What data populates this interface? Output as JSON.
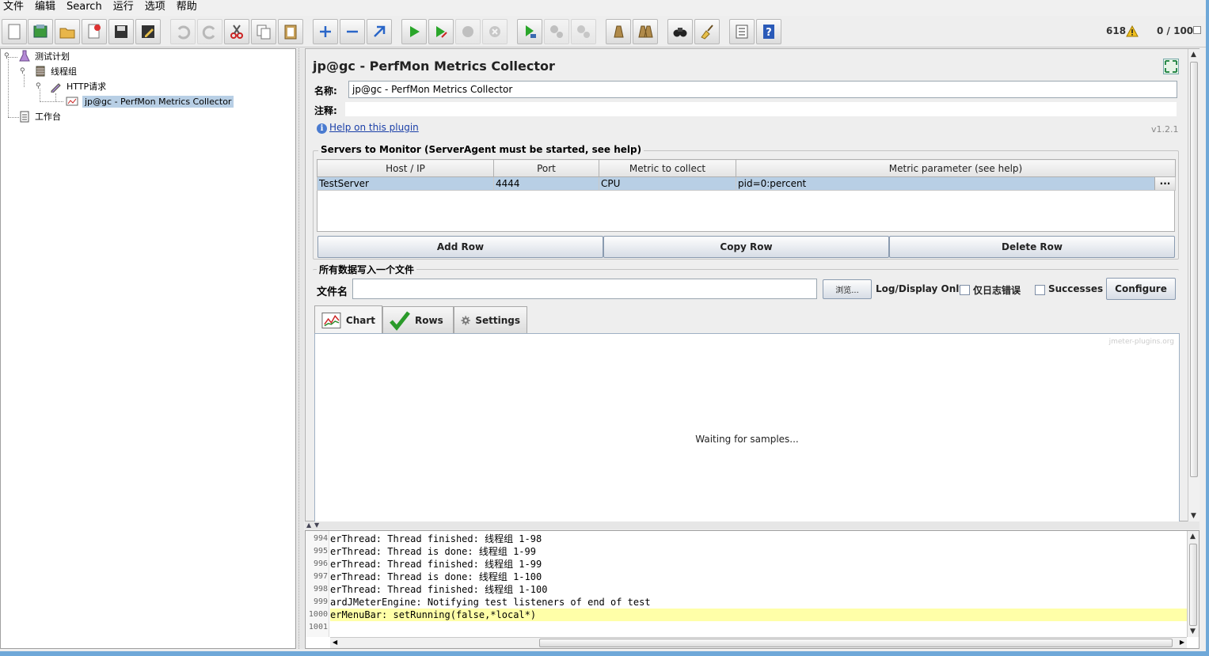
{
  "menu": [
    "文件",
    "编辑",
    "Search",
    "运行",
    "选项",
    "帮助"
  ],
  "toolbar_status": {
    "warnings": "618",
    "threads": "0 / 100"
  },
  "tree": {
    "test_plan": "测试计划",
    "thread_group": "线程组",
    "http_request": "HTTP请求",
    "collector": "jp@gc - PerfMon Metrics Collector",
    "workbench": "工作台"
  },
  "panel": {
    "title": "jp@gc - PerfMon Metrics Collector",
    "name_label": "名称:",
    "name_value": "jp@gc - PerfMon Metrics Collector",
    "comment_label": "注释:",
    "comment_value": "",
    "help_link": "Help on this plugin",
    "version": "v1.2.1"
  },
  "servers": {
    "title": "Servers to Monitor (ServerAgent must be started, see help)",
    "columns": [
      "Host / IP",
      "Port",
      "Metric to collect",
      "Metric parameter (see help)"
    ],
    "rows": [
      {
        "host": "TestServer",
        "port": "4444",
        "metric": "CPU",
        "param": "pid=0:percent"
      }
    ],
    "param_button": "...",
    "add_row": "Add Row",
    "copy_row": "Copy Row",
    "delete_row": "Delete Row"
  },
  "file_section": {
    "title": "所有数据写入一个文件",
    "filename_label": "文件名",
    "filename_value": "",
    "browse": "浏览...",
    "log_display_label": "Log/Display Only:",
    "errors_only": "仅日志错误",
    "successes": "Successes",
    "configure": "Configure"
  },
  "tabs": [
    {
      "label": "Chart",
      "icon": "chart-icon"
    },
    {
      "label": "Rows",
      "icon": "checkmark-icon"
    },
    {
      "label": "Settings",
      "icon": "gear-icon"
    }
  ],
  "chart": {
    "watermark": "jmeter-plugins.org",
    "message": "Waiting for samples..."
  },
  "log": {
    "lines": [
      {
        "n": "994",
        "text": "erThread: Thread finished: 线程组 1-98"
      },
      {
        "n": "995",
        "text": "erThread: Thread is done: 线程组 1-99"
      },
      {
        "n": "996",
        "text": "erThread: Thread finished: 线程组 1-99"
      },
      {
        "n": "997",
        "text": "erThread: Thread is done: 线程组 1-100"
      },
      {
        "n": "998",
        "text": "erThread: Thread finished: 线程组 1-100"
      },
      {
        "n": "999",
        "text": "ardJMeterEngine: Notifying test listeners of end of test"
      },
      {
        "n": "1000",
        "text": "erMenuBar: setRunning(false,*local*)"
      },
      {
        "n": "1001",
        "text": ""
      }
    ]
  },
  "colors": {
    "selection": "#b8cfe5",
    "highlight_line": "#ffffa8",
    "link": "#1a3fa8"
  }
}
